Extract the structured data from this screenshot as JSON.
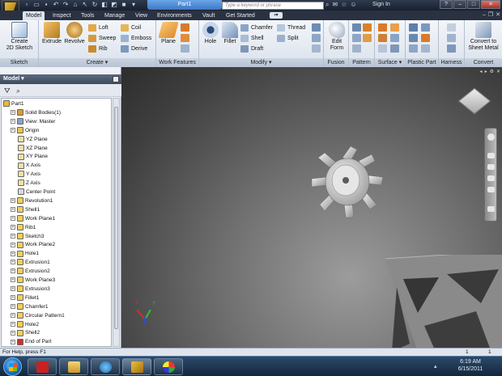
{
  "titlebar": {
    "document_title": "Part1",
    "search_placeholder": "Type a keyword or phrase",
    "sign_in": "Sign In",
    "help_icon": "?"
  },
  "tabs": [
    {
      "label": "Model"
    },
    {
      "label": "Inspect"
    },
    {
      "label": "Tools"
    },
    {
      "label": "Manage"
    },
    {
      "label": "View"
    },
    {
      "label": "Environments"
    },
    {
      "label": "Vault"
    },
    {
      "label": "Get Started"
    }
  ],
  "ribbon": {
    "sketch": {
      "button": "Create\n2D Sketch",
      "button_line1": "Create",
      "button_line2": "2D Sketch",
      "group": "Sketch"
    },
    "create": {
      "extrude": "Extrude",
      "revolve": "Revolve",
      "loft": "Loft",
      "sweep": "Sweep",
      "rib": "Rib",
      "coil": "Coil",
      "emboss": "Emboss",
      "derive": "Derive",
      "group": "Create"
    },
    "work_features": {
      "plane": "Plane",
      "group": "Work Features"
    },
    "modify": {
      "hole": "Hole",
      "fillet": "Fillet",
      "chamfer": "Chamfer",
      "shell": "Shell",
      "draft": "Draft",
      "thread": "Thread",
      "split": "Split",
      "group": "Modify"
    },
    "fusion": {
      "button_line1": "Edit",
      "button_line2": "Form",
      "group": "Fusion"
    },
    "pattern": {
      "group": "Pattern"
    },
    "surface": {
      "group": "Surface"
    },
    "plastic_part": {
      "group": "Plastic Part"
    },
    "harness": {
      "group": "Harness"
    },
    "convert": {
      "button_line1": "Convert to",
      "button_line2": "Sheet Metal",
      "group": "Convert"
    }
  },
  "browser": {
    "title": "Model",
    "tree": [
      {
        "label": "Part1",
        "indent": 0
      },
      {
        "label": "Solid Bodies(1)",
        "indent": 1
      },
      {
        "label": "View: Master",
        "indent": 1
      },
      {
        "label": "Origin",
        "indent": 1
      },
      {
        "label": "YZ Plane",
        "indent": 2
      },
      {
        "label": "XZ Plane",
        "indent": 2
      },
      {
        "label": "XY Plane",
        "indent": 2
      },
      {
        "label": "X Axis",
        "indent": 2
      },
      {
        "label": "Y Axis",
        "indent": 2
      },
      {
        "label": "Z Axis",
        "indent": 2
      },
      {
        "label": "Center Point",
        "indent": 2
      },
      {
        "label": "Revolution1",
        "indent": 1
      },
      {
        "label": "Shell1",
        "indent": 1
      },
      {
        "label": "Work Plane1",
        "indent": 1
      },
      {
        "label": "Rib1",
        "indent": 1
      },
      {
        "label": "Sketch3",
        "indent": 1
      },
      {
        "label": "Work Plane2",
        "indent": 1
      },
      {
        "label": "Hole1",
        "indent": 1
      },
      {
        "label": "Extrusion1",
        "indent": 1
      },
      {
        "label": "Extrusion2",
        "indent": 1
      },
      {
        "label": "Work Plane3",
        "indent": 1
      },
      {
        "label": "Extrusion3",
        "indent": 1
      },
      {
        "label": "Fillet1",
        "indent": 1
      },
      {
        "label": "Chamfer1",
        "indent": 1
      },
      {
        "label": "Circular Pattern1",
        "indent": 1
      },
      {
        "label": "Hole2",
        "indent": 1
      },
      {
        "label": "Shell2",
        "indent": 1
      },
      {
        "label": "End of Part",
        "indent": 1
      }
    ]
  },
  "viewport": {
    "ucs_x": "X",
    "ucs_y": "Y"
  },
  "statusbar": {
    "help_text": "For Help, press F1",
    "count1": "1",
    "count2": "1"
  },
  "taskbar": {
    "time": "6:19 AM",
    "date": "6/15/2011"
  },
  "colors": {
    "accent_blue": "#3e78c4",
    "ribbon_bg": "#e8edf3",
    "viewport_mid": "#6f6f6f",
    "taskbar": "#1c3450"
  }
}
